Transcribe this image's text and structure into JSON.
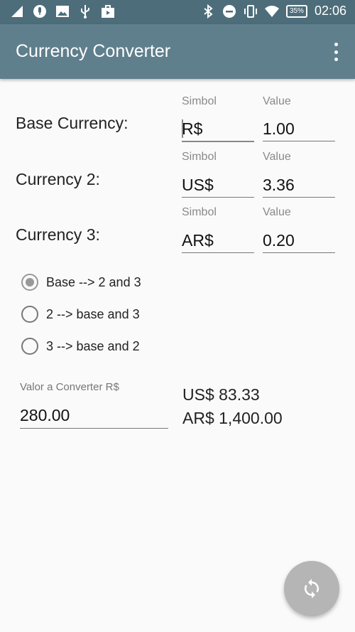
{
  "status_bar": {
    "time": "02:06",
    "battery": "35%",
    "icons": [
      "signal-icon",
      "mic-icon",
      "image-icon",
      "usb-icon",
      "bag-icon",
      "bluetooth-icon",
      "dnd-icon",
      "vibrate-icon",
      "wifi-icon",
      "battery-icon"
    ]
  },
  "app_bar": {
    "title": "Currency Converter",
    "menu_icon": "more-vert-icon"
  },
  "rows": [
    {
      "label": "Base Currency:",
      "symbol_hint": "Simbol",
      "value_hint": "Value",
      "symbol": "R$",
      "value": "1.00"
    },
    {
      "label": "Currency 2:",
      "symbol_hint": "Simbol",
      "value_hint": "Value",
      "symbol": "US$",
      "value": "3.36"
    },
    {
      "label": "Currency 3:",
      "symbol_hint": "Simbol",
      "value_hint": "Value",
      "symbol": "AR$",
      "value": "0.20"
    }
  ],
  "radios": [
    {
      "label": "Base --> 2 and 3",
      "checked": true
    },
    {
      "label": "2 --> base and 3",
      "checked": false
    },
    {
      "label": "3 --> base and 2",
      "checked": false
    }
  ],
  "convert": {
    "label": "Valor a Converter R$",
    "value": "280.00"
  },
  "results": [
    "US$ 83.33",
    "AR$ 1,400.00"
  ],
  "fab": {
    "icon": "sync-icon"
  },
  "colors": {
    "status_bar": "#4d6d7a",
    "app_bar": "#5f7f8c",
    "fab": "#b5b5b5"
  }
}
